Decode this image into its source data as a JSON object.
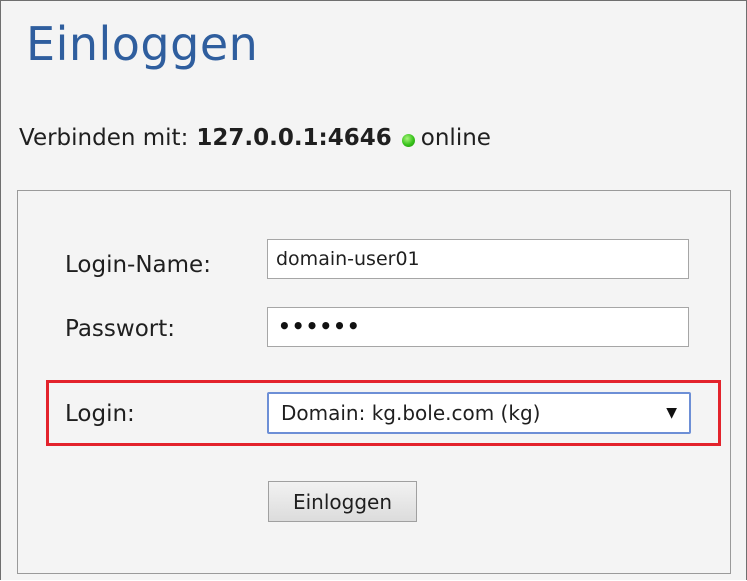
{
  "page": {
    "title": "Einloggen"
  },
  "connection": {
    "label": "Verbinden mit:",
    "host": "127.0.0.1:4646",
    "status": "online",
    "status_color": "#37c21b"
  },
  "form": {
    "login_name_label": "Login-Name:",
    "login_name_value": "domain-user01",
    "password_label": "Passwort:",
    "password_mask": "••••••",
    "login_label": "Login:",
    "login_selected": "Domain: kg.bole.com (kg)",
    "submit_label": "Einloggen"
  },
  "colors": {
    "title": "#2f5e9e",
    "highlight": "#e3232c"
  }
}
